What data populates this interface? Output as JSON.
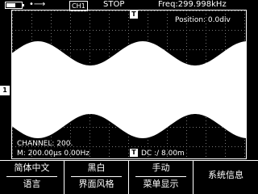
{
  "status_bar": {
    "battery_level": 0.6,
    "usb_icon": "usb-icon",
    "channel_label": "CH1",
    "run_state": "STOP",
    "frequency": "Freq:299.998kHz"
  },
  "waveform": {
    "position_text": "Position: 0.0div",
    "trigger_marker": "T",
    "channel_marker": "1",
    "channel_info": "CHANNEL: 200.",
    "time_info": "M: 200.00µs 0.00Hz",
    "time_marker": "T",
    "trigger_info": "DC :∕ 8.00m"
  },
  "menu": [
    {
      "top": "简体中文",
      "bottom": "语言"
    },
    {
      "top": "黑白",
      "bottom": "界面风格"
    },
    {
      "top": "手动",
      "bottom": "菜单显示"
    },
    {
      "single": "系统信息"
    }
  ]
}
